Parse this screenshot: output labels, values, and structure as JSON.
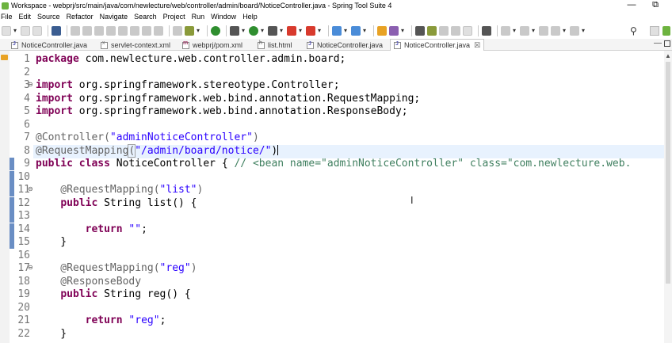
{
  "window": {
    "title": "Workspace - webprj/src/main/java/com/newlecture/web/controller/admin/board/NoticeController.java - Spring Tool Suite 4",
    "minimize": "—",
    "maximize": "⧉"
  },
  "menu": [
    "File",
    "Edit",
    "Source",
    "Refactor",
    "Navigate",
    "Search",
    "Project",
    "Run",
    "Window",
    "Help"
  ],
  "tabs": [
    {
      "label": "NoticeController.java",
      "icon": "java-file-icon",
      "active": false
    },
    {
      "label": "servlet-context.xml",
      "icon": "xml-file-icon",
      "active": false
    },
    {
      "label": "webprj/pom.xml",
      "icon": "maven-pom-icon",
      "active": false
    },
    {
      "label": "list.html",
      "icon": "html-file-icon",
      "active": false
    },
    {
      "label": "NoticeController.java",
      "icon": "java-file-icon",
      "active": false
    },
    {
      "label": "NoticeController.java",
      "icon": "java-file-icon",
      "active": true,
      "close": "☒"
    }
  ],
  "editor": {
    "line_numbers": [
      "1",
      "2",
      "3",
      "4",
      "5",
      "6",
      "7",
      "8",
      "9",
      "10",
      "11",
      "12",
      "13",
      "14",
      "15",
      "16",
      "17",
      "18",
      "19",
      "20",
      "21",
      "22"
    ],
    "lines": [
      [
        {
          "t": "package",
          "c": "kw"
        },
        {
          "t": " com.newlecture.web.controller.admin.board;",
          "c": ""
        }
      ],
      [],
      [
        {
          "t": "import",
          "c": "kw"
        },
        {
          "t": " org.springframework.stereotype.Controller;",
          "c": ""
        }
      ],
      [
        {
          "t": "import",
          "c": "kw"
        },
        {
          "t": " org.springframework.web.bind.annotation.RequestMapping;",
          "c": ""
        }
      ],
      [
        {
          "t": "import",
          "c": "kw"
        },
        {
          "t": " org.springframework.web.bind.annotation.ResponseBody;",
          "c": ""
        }
      ],
      [],
      [
        {
          "t": "@Controller(",
          "c": "ann"
        },
        {
          "t": "\"adminNoticeController\"",
          "c": "str"
        },
        {
          "t": ")",
          "c": "ann"
        }
      ],
      [
        {
          "t": "@RequestMapping",
          "c": "ann"
        },
        {
          "t": "(",
          "c": "mb"
        },
        {
          "t": "\"/admin/board/notice/\"",
          "c": "str"
        },
        {
          "t": ")",
          "c": ""
        }
      ],
      [
        {
          "t": "public",
          "c": "kw"
        },
        {
          "t": " ",
          "c": ""
        },
        {
          "t": "class",
          "c": "kw"
        },
        {
          "t": " NoticeController { ",
          "c": ""
        },
        {
          "t": "// <bean name=\"adminNoticeController\" class=\"com.newlecture.web.",
          "c": "cmt"
        }
      ],
      [],
      [
        {
          "t": "    @RequestMapping(",
          "c": "ann"
        },
        {
          "t": "\"list\"",
          "c": "str"
        },
        {
          "t": ")",
          "c": "ann"
        }
      ],
      [
        {
          "t": "    ",
          "c": ""
        },
        {
          "t": "public",
          "c": "kw"
        },
        {
          "t": " String list() {",
          "c": ""
        }
      ],
      [],
      [
        {
          "t": "        ",
          "c": ""
        },
        {
          "t": "return",
          "c": "kw"
        },
        {
          "t": " ",
          "c": ""
        },
        {
          "t": "\"\"",
          "c": "str"
        },
        {
          "t": ";",
          "c": ""
        }
      ],
      [
        {
          "t": "    }",
          "c": ""
        }
      ],
      [],
      [
        {
          "t": "    @RequestMapping(",
          "c": "ann"
        },
        {
          "t": "\"reg\"",
          "c": "str"
        },
        {
          "t": ")",
          "c": "ann"
        }
      ],
      [
        {
          "t": "    @ResponseBody",
          "c": "ann"
        }
      ],
      [
        {
          "t": "    ",
          "c": ""
        },
        {
          "t": "public",
          "c": "kw"
        },
        {
          "t": " String reg() {",
          "c": ""
        }
      ],
      [],
      [
        {
          "t": "        ",
          "c": ""
        },
        {
          "t": "return",
          "c": "kw"
        },
        {
          "t": " ",
          "c": ""
        },
        {
          "t": "\"reg\"",
          "c": "str"
        },
        {
          "t": ";",
          "c": ""
        }
      ],
      [
        {
          "t": "    }",
          "c": ""
        }
      ]
    ],
    "current_line": 8,
    "fold_lines": [
      3,
      11,
      17
    ],
    "change_lines": [
      9,
      10,
      11,
      12,
      13,
      14,
      15
    ]
  },
  "colors": {
    "keyword": "#7f0055",
    "annotation": "#646464",
    "string": "#2a00ff",
    "comment": "#3f7f5f",
    "current_line_bg": "#e8f2fe",
    "change_bar": "#6a8ec4"
  }
}
